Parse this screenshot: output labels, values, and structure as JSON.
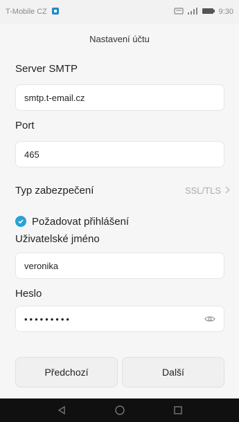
{
  "status_bar": {
    "carrier": "T-Mobile CZ",
    "time": "9:30"
  },
  "header": {
    "title": "Nastavení účtu"
  },
  "form": {
    "smtp_label": "Server SMTP",
    "smtp_value": "smtp.t-email.cz",
    "port_label": "Port",
    "port_value": "465",
    "security_label": "Typ zabezpečení",
    "security_value": "SSL/TLS",
    "auth_label": "Požadovat přihlášení",
    "auth_checked": true,
    "username_label": "Uživatelské jméno",
    "username_value": "veronika",
    "password_label": "Heslo",
    "password_value": "•••••••••"
  },
  "buttons": {
    "previous": "Předchozí",
    "next": "Další"
  },
  "colors": {
    "accent": "#27a3d6",
    "nav_bar": "#101010"
  },
  "icons": {
    "sim": "sim-icon",
    "signal": "signal-icon",
    "battery": "battery-icon",
    "chevron": "chevron-right-icon",
    "eye": "eye-icon",
    "back": "back-icon",
    "home": "home-icon",
    "recents": "recents-icon"
  }
}
